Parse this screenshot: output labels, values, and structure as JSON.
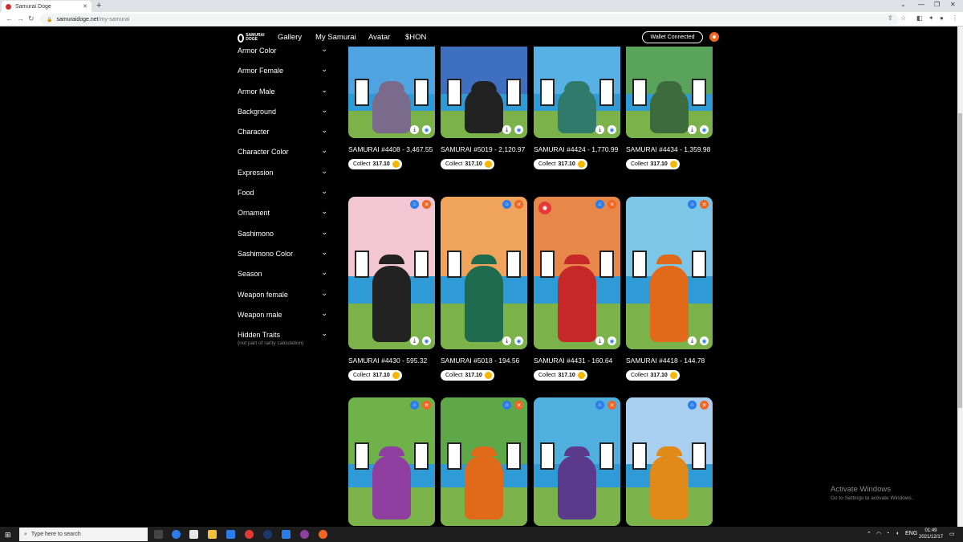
{
  "browser": {
    "tab_title": "Samurai Doge",
    "url_host": "samuraidoge.net",
    "url_path": "/my-samurai",
    "new_tab_symbol": "+",
    "close_symbol": "✕"
  },
  "site": {
    "logo_text": "SAMURAI DOGE",
    "nav": [
      "Gallery",
      "My Samurai",
      "Avatar",
      "$HON"
    ],
    "wallet_label": "Wallet Connected"
  },
  "filters": [
    "Armor Color",
    "Armor Female",
    "Armor Male",
    "Background",
    "Character",
    "Character Color",
    "Expression",
    "Food",
    "Ornament",
    "Sashimono",
    "Sashimono Color",
    "Season",
    "Weapon female",
    "Weapon male",
    "Hidden Traits"
  ],
  "hidden_traits_note": "(not part of rarity calculation)",
  "collect_label": "Collect",
  "cards": [
    {
      "name": "SAMURAI #4408 - 3,467.55",
      "amount": "317.10",
      "sky": "#4fa3e0",
      "armor": "#7a6a8c"
    },
    {
      "name": "SAMURAI #5019 - 2,120.97",
      "amount": "317.10",
      "sky": "#3f6fbf",
      "armor": "#222222"
    },
    {
      "name": "SAMURAI #4424 - 1,770.99",
      "amount": "317.10",
      "sky": "#58b1e4",
      "armor": "#2f7a6a"
    },
    {
      "name": "SAMURAI #4434 - 1,359.98",
      "amount": "317.10",
      "sky": "#5aa35a",
      "armor": "#3d6b3d"
    },
    {
      "name": "SAMURAI #4430 - 595.32",
      "amount": "317.10",
      "sky": "#f3c6d3",
      "armor": "#222222"
    },
    {
      "name": "SAMURAI #5018 - 194.56",
      "amount": "317.10",
      "sky": "#f0a35a",
      "armor": "#1f6b4f"
    },
    {
      "name": "SAMURAI #4431 - 160.64",
      "amount": "317.10",
      "sky": "#e8874a",
      "armor": "#c62828"
    },
    {
      "name": "SAMURAI #4418 - 144.78",
      "amount": "317.10",
      "sky": "#7cc6e8",
      "armor": "#e06a1a"
    },
    {
      "name": "",
      "amount": "",
      "sky": "#6fb24a",
      "armor": "#8e3fa0"
    },
    {
      "name": "",
      "amount": "",
      "sky": "#5fa84a",
      "armor": "#e06a1a"
    },
    {
      "name": "",
      "amount": "",
      "sky": "#4fb0e0",
      "armor": "#5b3a8c"
    },
    {
      "name": "",
      "amount": "",
      "sky": "#a9cff0",
      "armor": "#e08a1a"
    }
  ],
  "activate": {
    "title": "Activate Windows",
    "subtitle": "Go to Settings to activate Windows."
  },
  "taskbar": {
    "search_placeholder": "Type here to search",
    "lang": "ENG",
    "time": "01:49",
    "date": "2021/12/17"
  },
  "colors": {
    "accent": "#f26522",
    "link_blue": "#2b7de9",
    "coin": "#f5b800"
  }
}
